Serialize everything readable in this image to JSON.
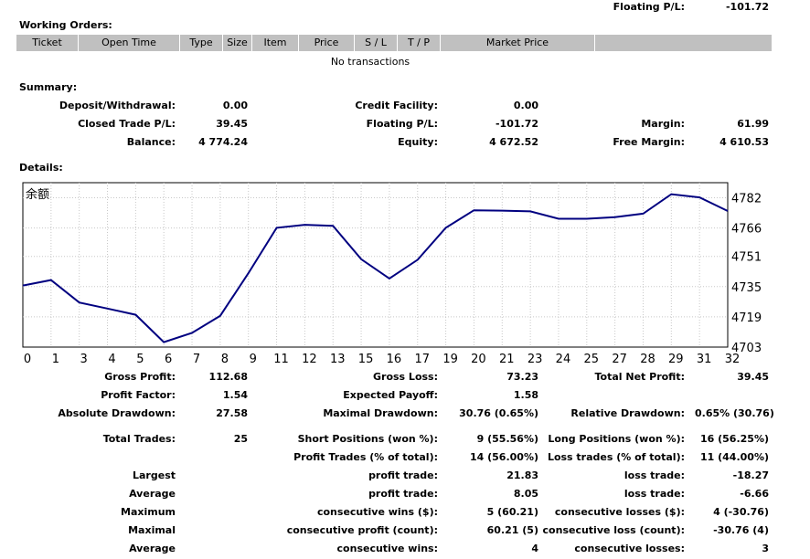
{
  "floating_top": {
    "label": "Floating P/L:",
    "value": "-101.72"
  },
  "working_orders": {
    "title": "Working Orders:",
    "columns": [
      "Ticket",
      "Open Time",
      "Type",
      "Size",
      "Item",
      "Price",
      "S / L",
      "T / P",
      "Market Price",
      ""
    ],
    "empty_text": "No transactions"
  },
  "summary": {
    "title": "Summary:",
    "rows": [
      [
        {
          "label": "Deposit/Withdrawal:",
          "value": "0.00"
        },
        {
          "label": "Credit Facility:",
          "value": "0.00"
        },
        {
          "label": "",
          "value": ""
        }
      ],
      [
        {
          "label": "Closed Trade P/L:",
          "value": "39.45"
        },
        {
          "label": "Floating P/L:",
          "value": "-101.72"
        },
        {
          "label": "Margin:",
          "value": "61.99"
        }
      ],
      [
        {
          "label": "Balance:",
          "value": "4 774.24"
        },
        {
          "label": "Equity:",
          "value": "4 672.52"
        },
        {
          "label": "Free Margin:",
          "value": "4 610.53"
        }
      ]
    ]
  },
  "details": {
    "title": "Details:"
  },
  "chart_data": {
    "type": "line",
    "title": "余额",
    "x": [
      0,
      1,
      2,
      3,
      4,
      5,
      6,
      7,
      8,
      9,
      10,
      11,
      12,
      13,
      14,
      15,
      16,
      17,
      18,
      19,
      20,
      21,
      22,
      23,
      24,
      25
    ],
    "values": [
      4735.6,
      4738.5,
      4726.6,
      4723.4,
      4720.1,
      4705.6,
      4710.5,
      4719.6,
      4742.1,
      4766.1,
      4767.7,
      4767.2,
      4749.5,
      4739.3,
      4749.2,
      4766.1,
      4775.4,
      4775.2,
      4774.8,
      4770.9,
      4770.9,
      4771.8,
      4773.6,
      4783.9,
      4782.2,
      4775.0
    ],
    "x_ticks": [
      "0",
      "1",
      "3",
      "4",
      "5",
      "6",
      "7",
      "8",
      "9",
      "11",
      "12",
      "13",
      "15",
      "16",
      "17",
      "19",
      "20",
      "21",
      "23",
      "24",
      "25",
      "27",
      "28",
      "29",
      "31",
      "32"
    ],
    "y_ticks": [
      "4782",
      "4766",
      "4751",
      "4735",
      "4719",
      "4703"
    ],
    "ylim": [
      4703,
      4790
    ],
    "grid": true,
    "line_color": "#000080"
  },
  "stats": {
    "row1": [
      {
        "label": "Gross Profit:",
        "value": "112.68"
      },
      {
        "label": "Gross Loss:",
        "value": "73.23"
      },
      {
        "label": "Total Net Profit:",
        "value": "39.45"
      }
    ],
    "row2": [
      {
        "label": "Profit Factor:",
        "value": "1.54"
      },
      {
        "label": "Expected Payoff:",
        "value": "1.58"
      }
    ],
    "row3": [
      {
        "label": "Absolute Drawdown:",
        "value": "27.58"
      },
      {
        "label": "Maximal Drawdown:",
        "value": "30.76 (0.65%)"
      },
      {
        "label": "Relative Drawdown:",
        "value": "0.65% (30.76)"
      }
    ],
    "trades": [
      [
        "Total Trades:",
        "25",
        "Short Positions (won %):",
        "9 (55.56%)",
        "Long Positions (won %):",
        "16 (56.25%)"
      ],
      [
        "",
        "",
        "Profit Trades (% of total):",
        "14 (56.00%)",
        "Loss trades (% of total):",
        "11 (44.00%)"
      ],
      [
        "Largest",
        "",
        "profit trade:",
        "21.83",
        "loss trade:",
        "-18.27"
      ],
      [
        "Average",
        "",
        "profit trade:",
        "8.05",
        "loss trade:",
        "-6.66"
      ],
      [
        "Maximum",
        "",
        "consecutive wins ($):",
        "5 (60.21)",
        "consecutive losses ($):",
        "4 (-30.76)"
      ],
      [
        "Maximal",
        "",
        "consecutive profit (count):",
        "60.21 (5)",
        "consecutive loss (count):",
        "-30.76 (4)"
      ],
      [
        "Average",
        "",
        "consecutive wins:",
        "4",
        "consecutive losses:",
        "3"
      ]
    ]
  }
}
